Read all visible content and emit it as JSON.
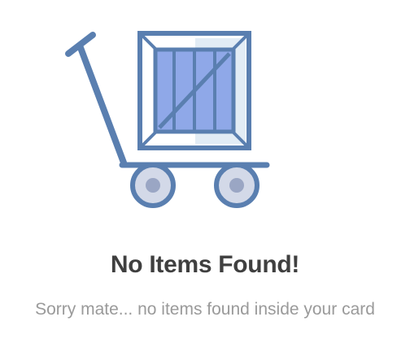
{
  "empty_state": {
    "illustration_icon": "hand-truck-with-crate-icon",
    "title": "No Items Found!",
    "message": "Sorry mate... no items found inside your card"
  },
  "colors": {
    "outline": "#5a7fb0",
    "crate_fill": "#8fa8e8",
    "crate_light": "#e2ecf5",
    "wheel_fill": "#d3d9e8",
    "hub_fill": "#9aa6c4",
    "title": "#3f3f3f",
    "message": "#9a9a9a",
    "background": "#ffffff"
  }
}
